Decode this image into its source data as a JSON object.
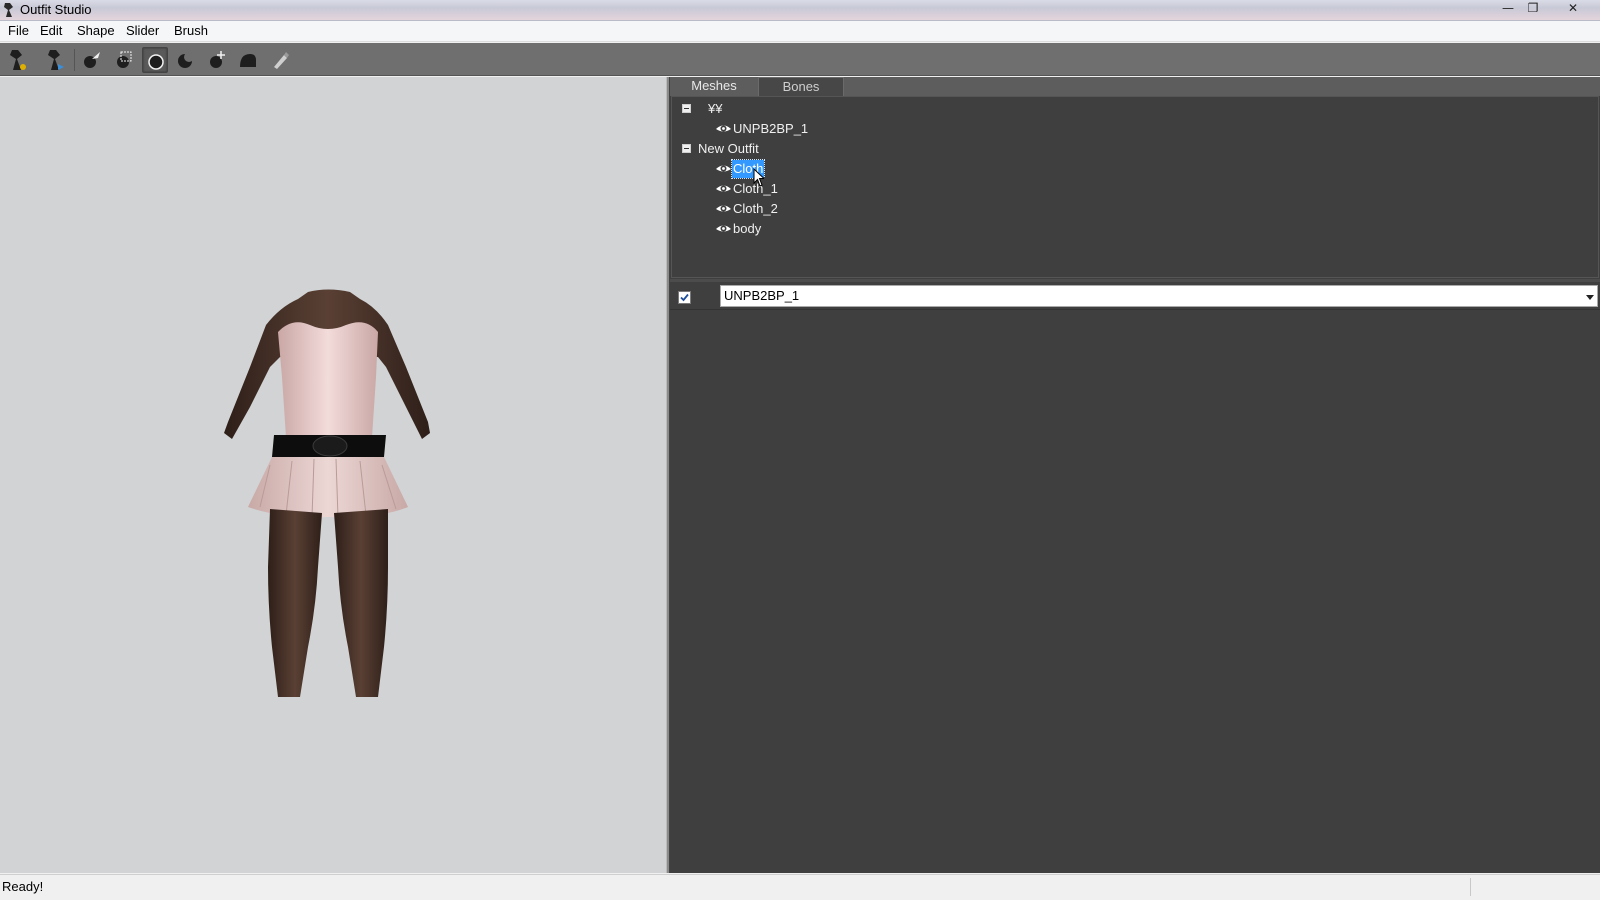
{
  "window": {
    "title": "Outfit Studio",
    "controls": {
      "minimize": "—",
      "maximize": "❐",
      "close": "✕"
    }
  },
  "menu": {
    "items": [
      "File",
      "Edit",
      "Shape",
      "Slider",
      "Brush"
    ]
  },
  "toolbar": {
    "tools": [
      {
        "name": "load-reference-icon",
        "active": false
      },
      {
        "name": "load-outfit-icon",
        "active": false
      },
      {
        "name": "select-brush-icon",
        "active": false
      },
      {
        "name": "mask-brush-icon",
        "active": false
      },
      {
        "name": "inflate-brush-icon",
        "active": true
      },
      {
        "name": "deflate-brush-icon",
        "active": false
      },
      {
        "name": "move-brush-icon",
        "active": false
      },
      {
        "name": "smooth-brush-icon",
        "active": false
      },
      {
        "name": "weight-brush-icon",
        "active": false
      }
    ]
  },
  "panel": {
    "tabs": {
      "meshes": "Meshes",
      "bones": "Bones"
    },
    "tree": {
      "reference_group": "¥¥",
      "reference_items": [
        "UNPB2BP_1"
      ],
      "outfit_group": "New Outfit",
      "outfit_items": [
        "Cloth",
        "Cloth_1",
        "Cloth_2",
        "body"
      ],
      "selected_item": "Cloth"
    },
    "reference": {
      "checked": true,
      "selected": "UNPB2BP_1"
    }
  },
  "colors": {
    "viewport_bg": "#d1d3d5",
    "panel_bg": "#3f3f3f",
    "toolbar_bg": "#6f6f6f",
    "selection": "#3399ff"
  },
  "status": {
    "text": "Ready!"
  }
}
